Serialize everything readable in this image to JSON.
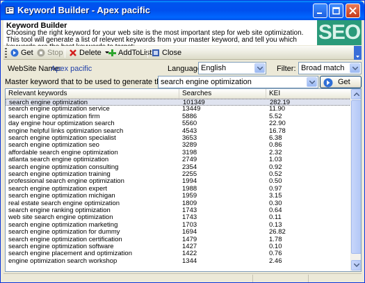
{
  "window": {
    "title": "Keyword Builder - Apex pacific"
  },
  "banner": {
    "title": "Keyword Builder",
    "description": "Choosing the right keyword for your web site is the most important step for web site optimization. This tool will generate a list of relevent keywords from your master keyword, and tell you which keywords are the best keywords to target:",
    "logo_text": "SEO"
  },
  "toolbar": {
    "get_label": "Get",
    "stop_label": "Stop",
    "delete_label": "Delete",
    "add_label": "AddToList",
    "close_label": "Close"
  },
  "form": {
    "website_label": "WebSite Name:",
    "website_value": "Apex pacific",
    "language_label": "Language:",
    "language_value": "English",
    "filter_label": "Filter:",
    "filter_value": "Broad match",
    "master_label": "Master keyword that to be used to generate the keyword list:",
    "master_value": "search engine optimization",
    "get_button": "Get"
  },
  "table": {
    "columns": [
      "Relevant keywords",
      "Searches",
      "KEI"
    ],
    "rows": [
      [
        "search engine optimization",
        "101349",
        "282.19"
      ],
      [
        "search engine optimization service",
        "13449",
        "11.90"
      ],
      [
        "search engine optimization firm",
        "5886",
        "5.52"
      ],
      [
        "day engine hour optimization search",
        "5560",
        "22.90"
      ],
      [
        "engine helpful links optimization search",
        "4543",
        "16.78"
      ],
      [
        "search engine optimization specialist",
        "3653",
        "6.38"
      ],
      [
        "search engine optimization seo",
        "3289",
        "0.86"
      ],
      [
        "affordable search engine optimization",
        "3198",
        "2.32"
      ],
      [
        "atlanta search engine optimization",
        "2749",
        "1.03"
      ],
      [
        "search engine optimization consulting",
        "2354",
        "0.92"
      ],
      [
        "search engine optimization training",
        "2255",
        "0.52"
      ],
      [
        "professional search engine optimization",
        "1994",
        "0.50"
      ],
      [
        "search engine optimization expert",
        "1988",
        "0.97"
      ],
      [
        "search engine optimization michigan",
        "1959",
        "3.15"
      ],
      [
        "real estate search engine optimization",
        "1809",
        "0.30"
      ],
      [
        "search engine ranking optimization",
        "1743",
        "0.64"
      ],
      [
        "web site search engine optimization",
        "1743",
        "0.11"
      ],
      [
        "search engine optimization marketing",
        "1703",
        "0.13"
      ],
      [
        "search engine optimization for dummy",
        "1694",
        "26.82"
      ],
      [
        "search engine optimization certification",
        "1479",
        "1.78"
      ],
      [
        "search engine optimization software",
        "1427",
        "0.10"
      ],
      [
        "search engine placement and optimization",
        "1422",
        "0.76"
      ],
      [
        "engine optimization search workshop",
        "1344",
        "2.46"
      ]
    ],
    "selected_row": 0
  }
}
